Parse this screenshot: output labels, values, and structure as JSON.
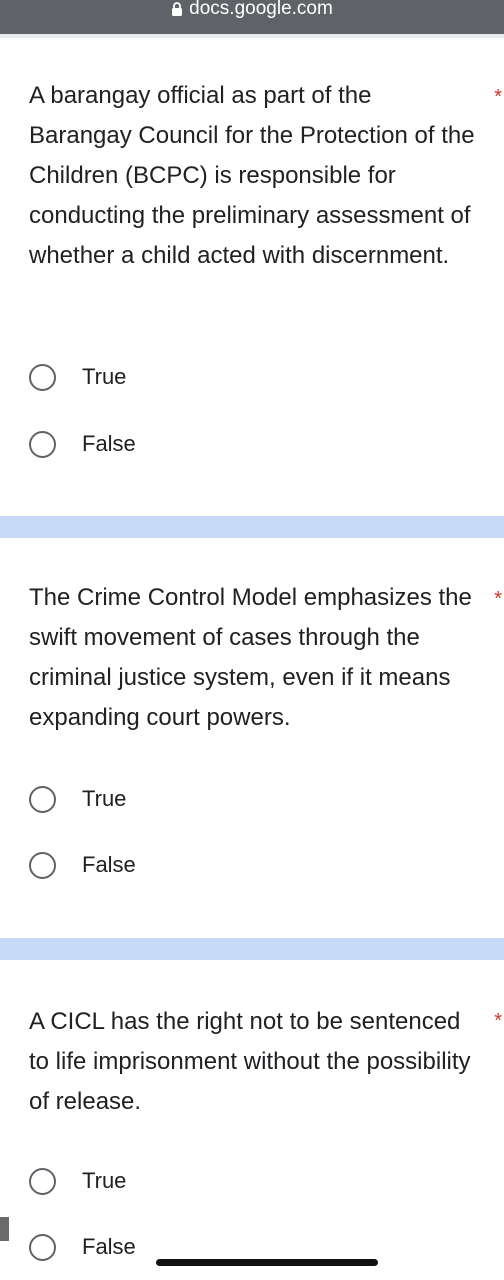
{
  "browser": {
    "url": "docs.google.com",
    "lock_icon": "lock-icon"
  },
  "questions": [
    {
      "text": "A barangay official as part of the Barangay Council for the Protection of the Children (BCPC) is responsible for conducting the preliminary assessment of whether a child acted with discernment.",
      "required_mark": "*",
      "options": [
        "True",
        "False"
      ]
    },
    {
      "text": "The Crime Control Model emphasizes the swift movement of cases through the criminal justice system, even if it means expanding court powers.",
      "required_mark": "*",
      "options": [
        "True",
        "False"
      ]
    },
    {
      "text": "A CICL has the right not to be sentenced to life imprisonment without the possibility of release.",
      "required_mark": "*",
      "options": [
        "True",
        "False"
      ]
    }
  ],
  "colors": {
    "required": "#d93025",
    "separator": "#c6d9f7",
    "radio_border": "#5f6368"
  }
}
